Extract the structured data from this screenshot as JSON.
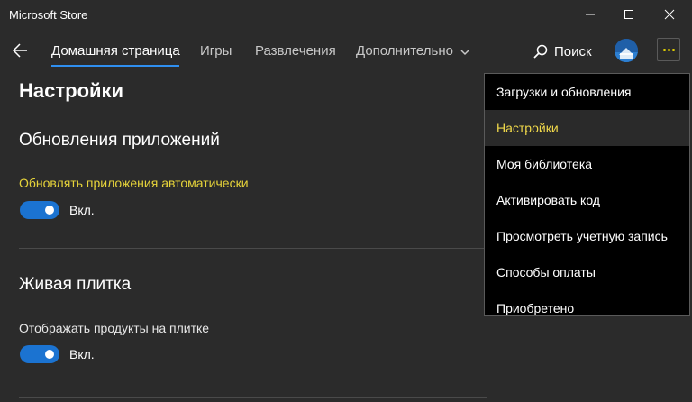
{
  "window": {
    "title": "Microsoft Store"
  },
  "nav": {
    "tabs": [
      {
        "label": "Домашняя страница",
        "active": true
      },
      {
        "label": "Игры"
      },
      {
        "label": "Развлечения"
      },
      {
        "label": "Дополнительно"
      }
    ],
    "search_label": "Поиск"
  },
  "page": {
    "title": "Настройки",
    "sections": [
      {
        "title": "Обновления приложений",
        "setting_label": "Обновлять приложения автоматически",
        "toggle_state": "Вкл."
      },
      {
        "title": "Живая плитка",
        "setting_label": "Отображать продукты на плитке",
        "toggle_state": "Вкл."
      }
    ]
  },
  "menu": {
    "items": [
      {
        "label": "Загрузки и обновления"
      },
      {
        "label": "Настройки",
        "selected": true
      },
      {
        "label": "Моя библиотека"
      },
      {
        "label": "Активировать код"
      },
      {
        "label": "Просмотреть учетную запись"
      },
      {
        "label": "Способы оплаты"
      },
      {
        "label": "Приобретено"
      }
    ]
  },
  "colors": {
    "accent": "#1b73d1",
    "highlight": "#e6d33a",
    "background": "#2b2b2b",
    "menu_bg": "#000000"
  }
}
